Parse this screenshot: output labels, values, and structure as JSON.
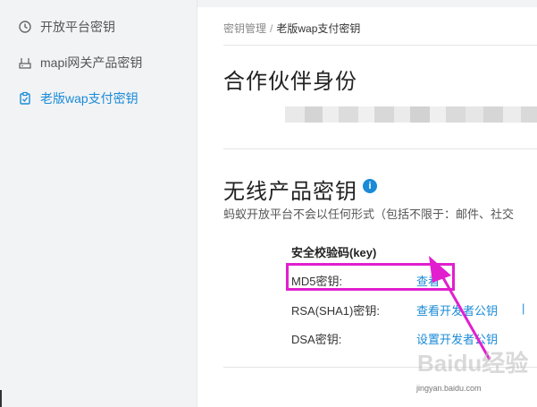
{
  "sidebar": {
    "items": [
      {
        "label": "开放平台密钥",
        "icon": "clock-icon",
        "active": false
      },
      {
        "label": "mapi网关产品密钥",
        "icon": "router-icon",
        "active": false
      },
      {
        "label": "老版wap支付密钥",
        "icon": "clipboard-icon",
        "active": true
      }
    ]
  },
  "breadcrumb": {
    "root": "密钥管理",
    "separator": "/",
    "current": "老版wap支付密钥"
  },
  "partner_section": {
    "title": "合作伙伴身份"
  },
  "wireless_section": {
    "title": "无线产品密钥",
    "info_icon": "info-icon",
    "description": "蚂蚁开放平台不会以任何形式（包括不限于：邮件、社交"
  },
  "key_table": {
    "header": "安全校验码(key)",
    "rows": [
      {
        "label": "MD5密钥:",
        "link": "查看"
      },
      {
        "label": "RSA(SHA1)密钥:",
        "link": "查看开发者公钥",
        "extra": "|"
      },
      {
        "label": "DSA密钥:",
        "link": "设置开发者公钥"
      }
    ]
  },
  "annotation": {
    "highlight_color": "#e11fcf",
    "arrow_color": "#e11fcf"
  },
  "watermark": {
    "text": "jingyan.baidu.com",
    "brand": "Baidu经验"
  },
  "colors": {
    "accent": "#1a8bd6",
    "sidebar_bg": "#f2f3f5"
  }
}
